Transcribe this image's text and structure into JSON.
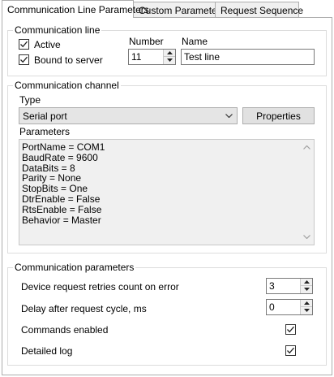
{
  "tabs": [
    {
      "label": "Communication Line Parameters",
      "active": true
    },
    {
      "label": "Custom Parameters",
      "active": false
    },
    {
      "label": "Request Sequence",
      "active": false
    }
  ],
  "communication_line": {
    "group_title": "Communication line",
    "active_label": "Active",
    "active_checked": true,
    "bound_label": "Bound to server",
    "bound_checked": true,
    "number_label": "Number",
    "number_value": "11",
    "name_label": "Name",
    "name_value": "Test line"
  },
  "communication_channel": {
    "group_title": "Communication channel",
    "type_label": "Type",
    "type_value": "Serial port",
    "properties_label": "Properties",
    "parameters_label": "Parameters",
    "parameters_lines": [
      "PortName = COM1",
      "BaudRate = 9600",
      "DataBits = 8",
      "Parity = None",
      "StopBits = One",
      "DtrEnable = False",
      "RtsEnable = False",
      "Behavior = Master"
    ]
  },
  "communication_parameters": {
    "group_title": "Communication parameters",
    "retries_label": "Device request retries count on error",
    "retries_value": "3",
    "delay_label": "Delay after request cycle, ms",
    "delay_value": "0",
    "commands_label": "Commands enabled",
    "commands_checked": true,
    "log_label": "Detailed log",
    "log_checked": true
  }
}
